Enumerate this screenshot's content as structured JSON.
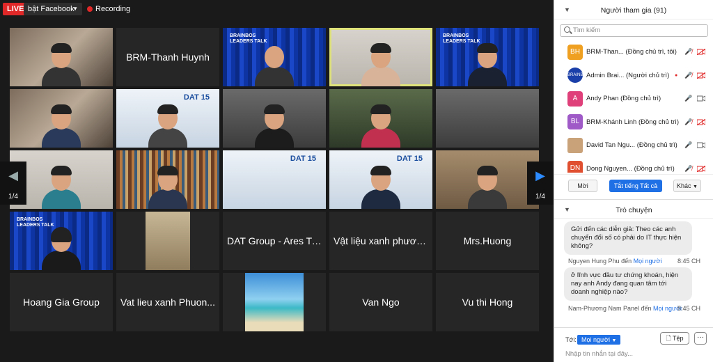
{
  "topbar": {
    "live_label": "LIVE",
    "stream_target": "bật Facebook",
    "recording_label": "Recording"
  },
  "grid": {
    "tiles": [
      {
        "name": "",
        "video": true
      },
      {
        "name": "BRM-Thanh Huynh",
        "video": false
      },
      {
        "name": "",
        "video": true
      },
      {
        "name": "",
        "video": true,
        "active": true
      },
      {
        "name": "",
        "video": true
      },
      {
        "name": "",
        "video": true
      },
      {
        "name": "",
        "video": true
      },
      {
        "name": "",
        "video": true
      },
      {
        "name": "",
        "video": true
      },
      {
        "name": "",
        "video": true
      },
      {
        "name": "",
        "video": true
      },
      {
        "name": "",
        "video": true
      },
      {
        "name": "",
        "video": true
      },
      {
        "name": "",
        "video": true
      },
      {
        "name": "",
        "video": true
      },
      {
        "name": "",
        "video": true
      },
      {
        "name": "",
        "video": true
      },
      {
        "name": "DAT Group - Ares Tr...",
        "video": false
      },
      {
        "name": "Vật liệu xanh phươn...",
        "video": false
      },
      {
        "name": "Mrs.Huong",
        "video": false
      },
      {
        "name": "Hoang Gia Group",
        "video": false
      },
      {
        "name": "Vat lieu xanh Phuon...",
        "video": false
      },
      {
        "name": "",
        "video": true
      },
      {
        "name": "Van Ngo",
        "video": false
      },
      {
        "name": "Vu thi Hong",
        "video": false
      }
    ],
    "brand_text": "BRAINBOS\nLEADERS TALK",
    "dat_logo": "DAT 15",
    "page_left": "1/4",
    "page_right": "1/4"
  },
  "participants": {
    "title": "Người tham gia (91)",
    "search_placeholder": "Tìm kiếm",
    "items": [
      {
        "initials": "BH",
        "color": "#f0a020",
        "name": "BRM-Than... (Đồng chủ trì, tôi)",
        "mic": "off",
        "cam": "off"
      },
      {
        "initials": "B",
        "color": "#1b3fa8",
        "name": "Admin Brai... (Người chủ trì)",
        "mic": "off",
        "cam": "off",
        "rec": true
      },
      {
        "initials": "A",
        "color": "#e0407a",
        "name": "Andy Phan (Đồng chủ trì)",
        "mic": "on",
        "cam": "on"
      },
      {
        "initials": "BL",
        "color": "#a05ac8",
        "name": "BRM-Khánh Linh (Đồng chủ trì)",
        "mic": "off",
        "cam": "off"
      },
      {
        "initials": "",
        "color": "#c9a27a",
        "name": "David Tan Ngu... (Đồng chủ trì)",
        "mic": "on",
        "cam": "on"
      },
      {
        "initials": "DN",
        "color": "#e05030",
        "name": "Dong Nguyen... (Đồng chủ trì)",
        "mic": "off",
        "cam": "off"
      }
    ],
    "btn_invite": "Mời",
    "btn_mute_all": "Tắt tiếng Tất cả",
    "btn_more": "Khác"
  },
  "chat": {
    "title": "Trò chuyện",
    "messages": [
      {
        "text": "Gửi đến các diễn giả: Theo các anh chuyển đổi số có phải do IT thực hiện không?"
      },
      {
        "sender": "Nguyen Hung Phu",
        "to_word": "đến",
        "to": "Mọi người",
        "time": "8:45 CH"
      },
      {
        "text": "ở lĩnh vực đầu tư chứng khoán, hiện nay anh Andy đang quan tâm tới doanh nghiệp nào?"
      },
      {
        "sender": "Nam-Phương Nam Panel",
        "to_word": "đến",
        "to": "Mọi người",
        "time": "8:45 CH"
      }
    ],
    "to_label": "Tới:",
    "to_value": "Mọi người",
    "file_button": "Tệp",
    "more_button": "···",
    "input_placeholder": "Nhập tin nhắn tại đây..."
  }
}
